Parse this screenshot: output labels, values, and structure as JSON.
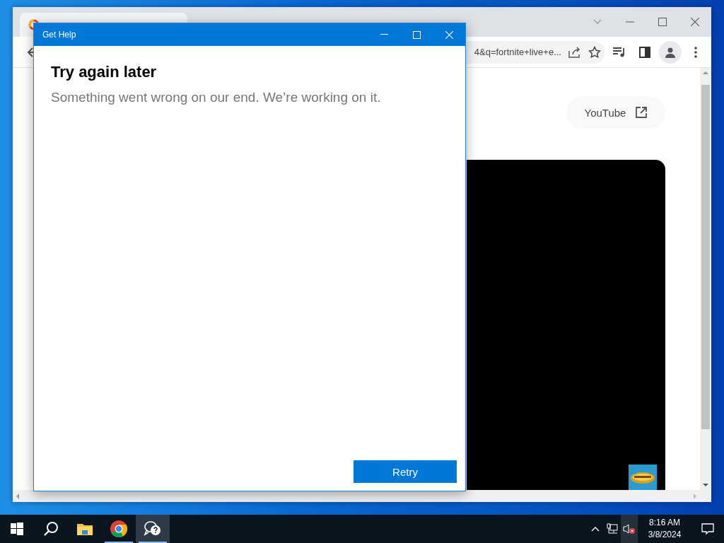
{
  "browser": {
    "address_text": "4&q=fortnite+live+e...",
    "link_button": "YouTube"
  },
  "dialog": {
    "title": "Get Help",
    "heading": "Try again later",
    "message": "Something went wrong on our end. We’re working on it.",
    "button": "Retry"
  },
  "taskbar": {
    "apps": [
      {
        "kind": "explorer",
        "running": false,
        "selected": false
      },
      {
        "kind": "chrome",
        "running": true,
        "selected": false
      },
      {
        "kind": "help",
        "running": true,
        "selected": true
      }
    ],
    "sound_muted": true,
    "time": "8:16 AM",
    "date": "3/8/2024"
  }
}
